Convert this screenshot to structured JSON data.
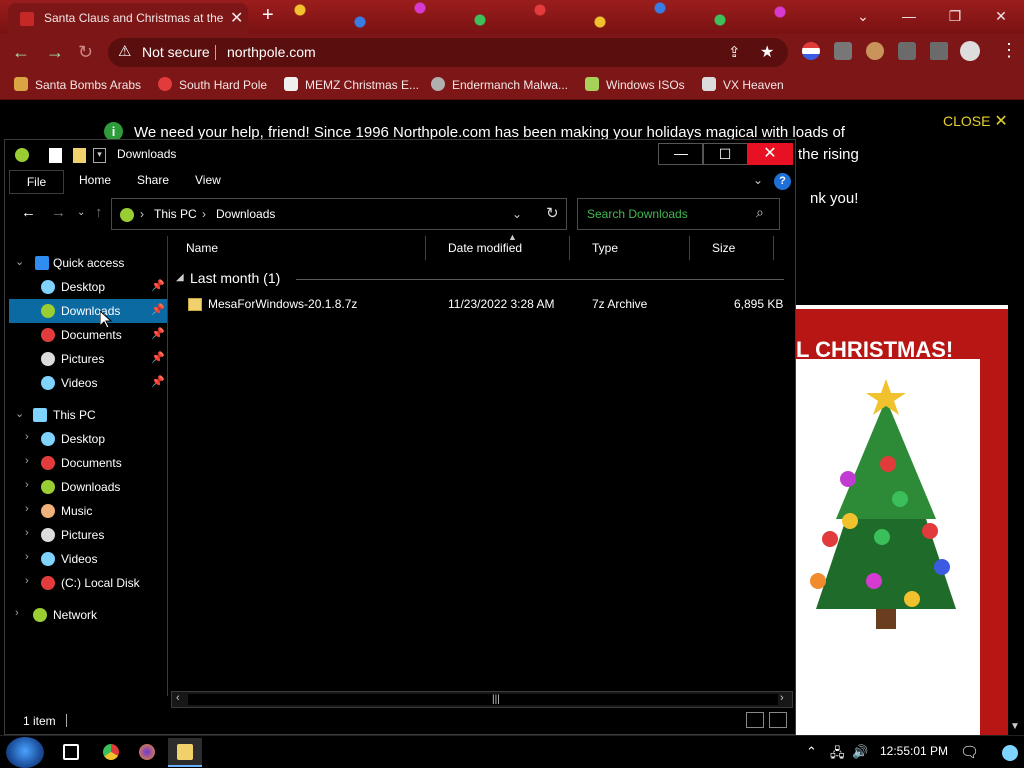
{
  "browser": {
    "tab_title": "Santa Claus and Christmas at the",
    "url": "northpole.com",
    "security_label": "Not secure",
    "bookmarks": [
      {
        "label": "Santa Bombs Arabs",
        "color": "#d9a441"
      },
      {
        "label": "South Hard Pole",
        "color": "#e23b3b"
      },
      {
        "label": "MEMZ Christmas E...",
        "color": "#f0f0f0"
      },
      {
        "label": "Endermanch Malwa...",
        "color": "#b0b0b0"
      },
      {
        "label": "Windows ISOs",
        "color": "#a8d15a"
      },
      {
        "label": "VX Heaven",
        "color": "#dcdcdc"
      }
    ]
  },
  "webpage": {
    "banner_text": "We need your help, friend! Since 1996 Northpole.com has been making your holidays magical with loads of … the rising … nk you!",
    "banner_line1": "We need your help, friend! Since 1996 Northpole.com has been making your holidays magical with loads of",
    "banner_line2": "the rising",
    "banner_line3": "nk you!",
    "close_label": "CLOSE",
    "christmas_heading": "L CHRISTMAS!"
  },
  "explorer": {
    "title": "Downloads",
    "ribbon_tabs": [
      "File",
      "Home",
      "Share",
      "View"
    ],
    "breadcrumb": [
      "This PC",
      "Downloads"
    ],
    "search_placeholder": "Search Downloads",
    "columns": [
      "Name",
      "Date modified",
      "Type",
      "Size"
    ],
    "group_label": "Last month (1)",
    "files": [
      {
        "name": "MesaForWindows-20.1.8.7z",
        "date": "11/23/2022 3:28 AM",
        "type": "7z Archive",
        "size": "6,895 KB"
      }
    ],
    "nav": {
      "quick_access_label": "Quick access",
      "quick_access": [
        {
          "label": "Desktop",
          "icon_color": "#7fd3ff"
        },
        {
          "label": "Downloads",
          "icon_color": "#9acd32"
        },
        {
          "label": "Documents",
          "icon_color": "#e23b3b"
        },
        {
          "label": "Pictures",
          "icon_color": "#dcdcdc"
        },
        {
          "label": "Videos",
          "icon_color": "#7fd3ff"
        }
      ],
      "this_pc_label": "This PC",
      "this_pc": [
        {
          "label": "Desktop",
          "icon_color": "#7fd3ff"
        },
        {
          "label": "Documents",
          "icon_color": "#e23b3b"
        },
        {
          "label": "Downloads",
          "icon_color": "#9acd32"
        },
        {
          "label": "Music",
          "icon_color": "#f0b27a"
        },
        {
          "label": "Pictures",
          "icon_color": "#dcdcdc"
        },
        {
          "label": "Videos",
          "icon_color": "#7fd3ff"
        },
        {
          "label": "(C:) Local Disk",
          "icon_color": "#e23b3b"
        }
      ],
      "network_label": "Network"
    },
    "status": "1 item"
  },
  "taskbar": {
    "clock": "12:55:01 PM"
  },
  "colors": {
    "selection": "#0c6aa3",
    "close_red": "#e81123",
    "search_green": "#3fb950"
  }
}
